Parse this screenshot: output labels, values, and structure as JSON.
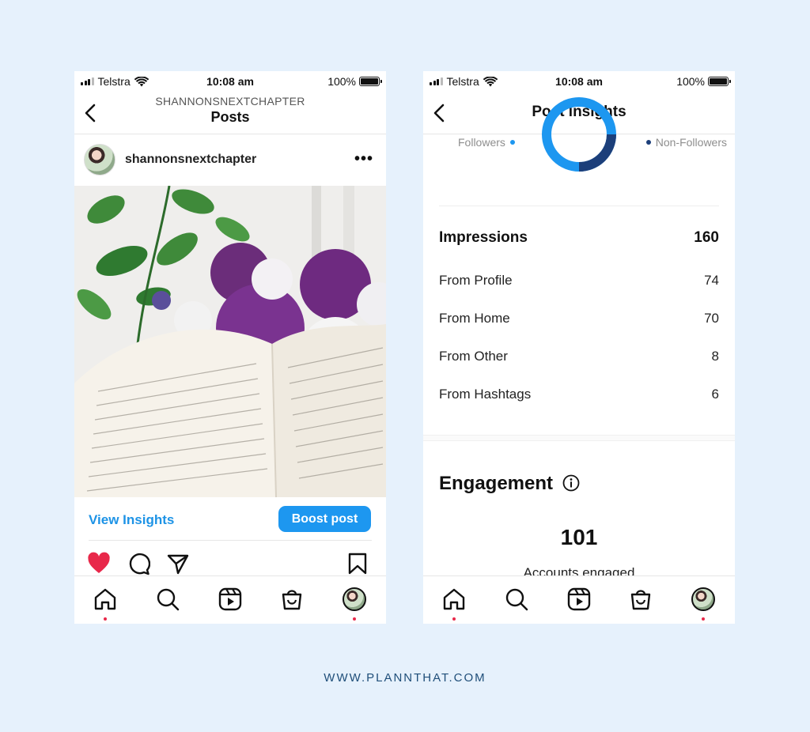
{
  "brand": {
    "accent": "#1d97f0",
    "background": "#e6f1fc",
    "like_color": "#e8284a",
    "donut_followers": "#1d97f0",
    "donut_non_followers": "#1c3f7a"
  },
  "left_screen": {
    "status": {
      "carrier": "Telstra",
      "time": "10:08 am",
      "battery": "100%"
    },
    "header": {
      "subtitle": "SHANNONSNEXTCHAPTER",
      "title": "Posts"
    },
    "post": {
      "username": "shannonsnextchapter",
      "more_icon": "more-dots-icon"
    },
    "actions": {
      "view_insights": "View Insights",
      "boost": "Boost post"
    },
    "action_icons": [
      "heart-filled-icon",
      "comment-icon",
      "share-icon",
      "bookmark-icon"
    ]
  },
  "right_screen": {
    "status": {
      "carrier": "Telstra",
      "time": "10:08 am",
      "battery": "100%"
    },
    "header": {
      "title": "Post insights"
    },
    "legend": {
      "followers": "Followers",
      "non_followers": "Non-Followers"
    },
    "impressions": {
      "label": "Impressions",
      "value": "160",
      "rows": [
        {
          "label": "From Profile",
          "value": "74"
        },
        {
          "label": "From Home",
          "value": "70"
        },
        {
          "label": "From Other",
          "value": "8"
        },
        {
          "label": "From Hashtags",
          "value": "6"
        }
      ]
    },
    "engagement": {
      "title": "Engagement",
      "value": "101",
      "label": "Accounts engaged"
    }
  },
  "bottom_nav": [
    "home-icon",
    "search-icon",
    "reels-icon",
    "shop-icon",
    "profile-avatar"
  ],
  "footer": {
    "url": "WWW.PLANNTHAT.COM"
  }
}
